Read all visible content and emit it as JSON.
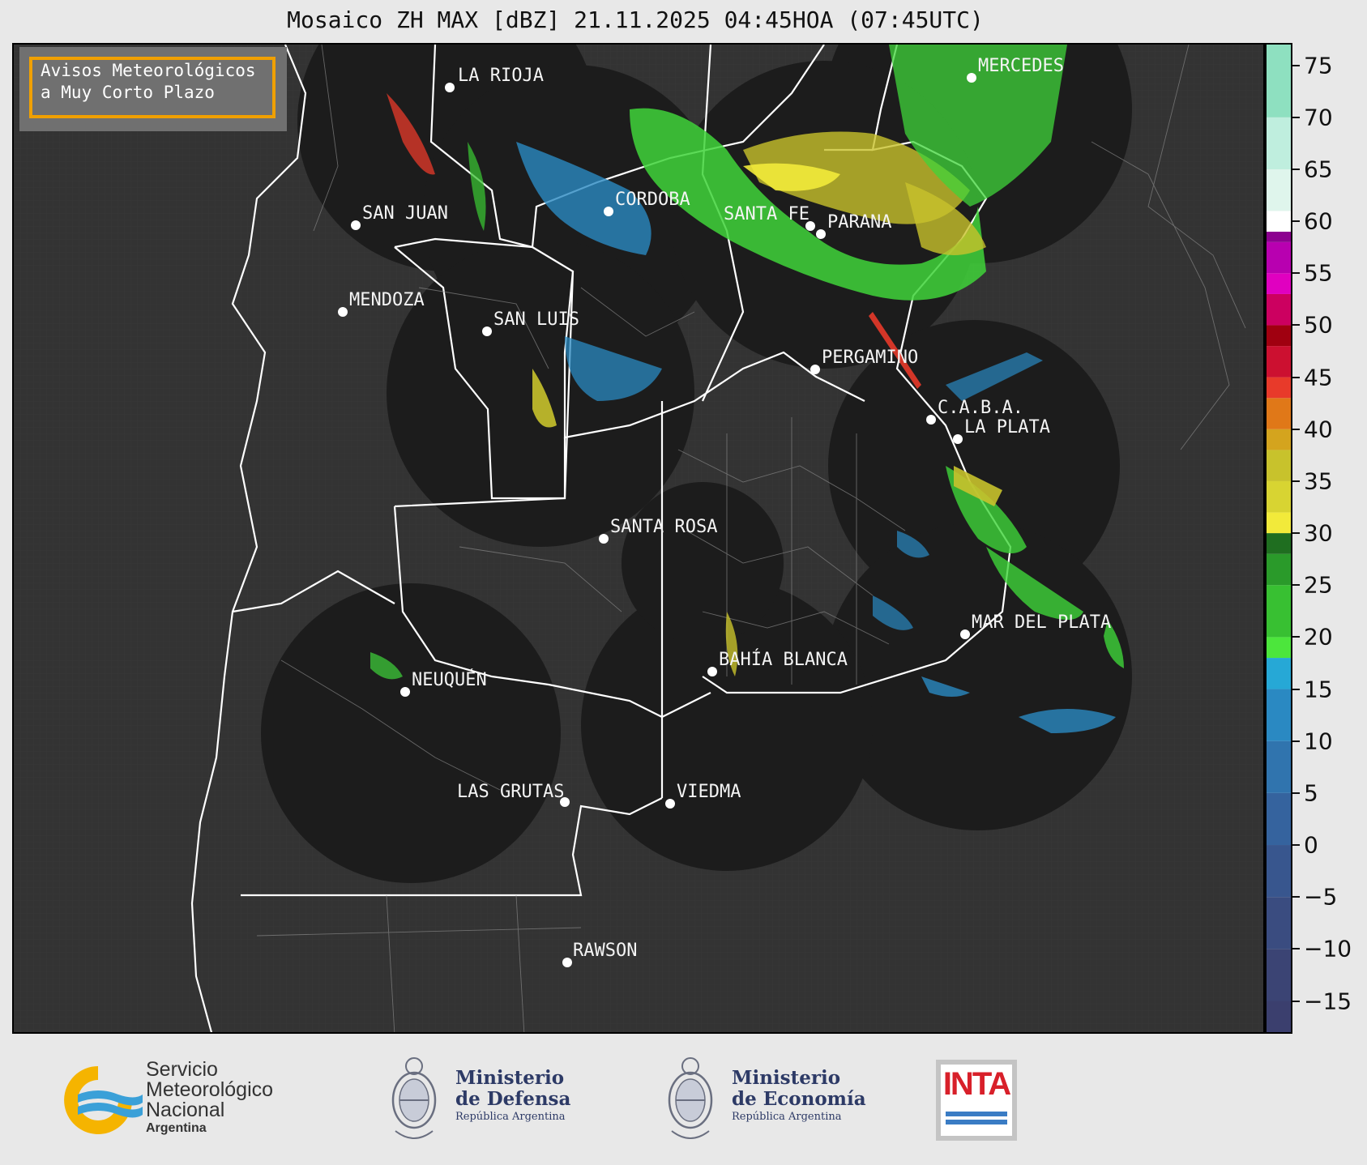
{
  "title": "Mosaico ZH MAX [dBZ] 21.11.2025 04:45HOA (07:45UTC)",
  "badge": {
    "line1": "Avisos Meteorológicos",
    "line2": "a Muy Corto Plazo",
    "border_color": "#f0a000"
  },
  "cities": [
    {
      "name": "LA RIOJA"
    },
    {
      "name": "MERCEDES"
    },
    {
      "name": "CORDOBA"
    },
    {
      "name": "SAN JUAN"
    },
    {
      "name": "SANTA FE"
    },
    {
      "name": "PARANA"
    },
    {
      "name": "MENDOZA"
    },
    {
      "name": "SAN LUIS"
    },
    {
      "name": "PERGAMINO"
    },
    {
      "name": "C.A.B.A."
    },
    {
      "name": "LA PLATA"
    },
    {
      "name": "SANTA ROSA"
    },
    {
      "name": "MAR DEL PLATA"
    },
    {
      "name": "BAHÍA BLANCA"
    },
    {
      "name": "NEUQUÉN"
    },
    {
      "name": "LAS GRUTAS"
    },
    {
      "name": "VIEDMA"
    },
    {
      "name": "RAWSON"
    }
  ],
  "colorbar": {
    "min": -18,
    "max": 77,
    "ticks": [
      75,
      70,
      65,
      60,
      55,
      50,
      45,
      40,
      35,
      30,
      25,
      20,
      15,
      10,
      5,
      0,
      -5,
      -10,
      -15
    ],
    "tick_labels": [
      "75",
      "70",
      "65",
      "60",
      "55",
      "50",
      "45",
      "40",
      "35",
      "30",
      "25",
      "20",
      "15",
      "10",
      "5",
      "0",
      "−5",
      "−10",
      "−15"
    ],
    "segments": [
      {
        "from": -18,
        "to": -15,
        "color": "#3b3f6e"
      },
      {
        "from": -15,
        "to": -10,
        "color": "#3b4474"
      },
      {
        "from": -10,
        "to": -5,
        "color": "#3a4c80"
      },
      {
        "from": -5,
        "to": 0,
        "color": "#38568e"
      },
      {
        "from": 0,
        "to": 5,
        "color": "#35639e"
      },
      {
        "from": 5,
        "to": 10,
        "color": "#3074ae"
      },
      {
        "from": 10,
        "to": 15,
        "color": "#2a89c2"
      },
      {
        "from": 15,
        "to": 18,
        "color": "#26a8d6"
      },
      {
        "from": 18,
        "to": 20,
        "color": "#4ce63c"
      },
      {
        "from": 20,
        "to": 25,
        "color": "#38c032"
      },
      {
        "from": 25,
        "to": 28,
        "color": "#2a9a2a"
      },
      {
        "from": 28,
        "to": 30,
        "color": "#1f6e20"
      },
      {
        "from": 30,
        "to": 32,
        "color": "#f2ea3a"
      },
      {
        "from": 32,
        "to": 35,
        "color": "#d8d432"
      },
      {
        "from": 35,
        "to": 38,
        "color": "#c8c22c"
      },
      {
        "from": 38,
        "to": 40,
        "color": "#d4a41e"
      },
      {
        "from": 40,
        "to": 43,
        "color": "#e07818"
      },
      {
        "from": 43,
        "to": 45,
        "color": "#e83a2a"
      },
      {
        "from": 45,
        "to": 48,
        "color": "#cc1030"
      },
      {
        "from": 48,
        "to": 50,
        "color": "#a00010"
      },
      {
        "from": 50,
        "to": 53,
        "color": "#cc0060"
      },
      {
        "from": 53,
        "to": 55,
        "color": "#e000c0"
      },
      {
        "from": 55,
        "to": 58,
        "color": "#b800b0"
      },
      {
        "from": 58,
        "to": 59,
        "color": "#8c0090"
      },
      {
        "from": 59,
        "to": 61,
        "color": "#ffffff"
      },
      {
        "from": 61,
        "to": 65,
        "color": "#dff5ec"
      },
      {
        "from": 65,
        "to": 70,
        "color": "#bfeede"
      },
      {
        "from": 70,
        "to": 77,
        "color": "#8ee0c0"
      }
    ]
  },
  "footer": {
    "smn": {
      "line1": "Servicio",
      "line2": "Meteorológico",
      "line3": "Nacional",
      "line4": "Argentina"
    },
    "defensa": {
      "line1": "Ministerio",
      "line2": "de Defensa",
      "line3": "República Argentina"
    },
    "economia": {
      "line1": "Ministerio",
      "line2": "de Economía",
      "line3": "República Argentina"
    },
    "inta": {
      "text": "INTA"
    }
  },
  "colors": {
    "map_bg": "#333333",
    "radar_bg": "#1c1c1c",
    "border": "#ffffff",
    "accent": "#f0a000"
  }
}
